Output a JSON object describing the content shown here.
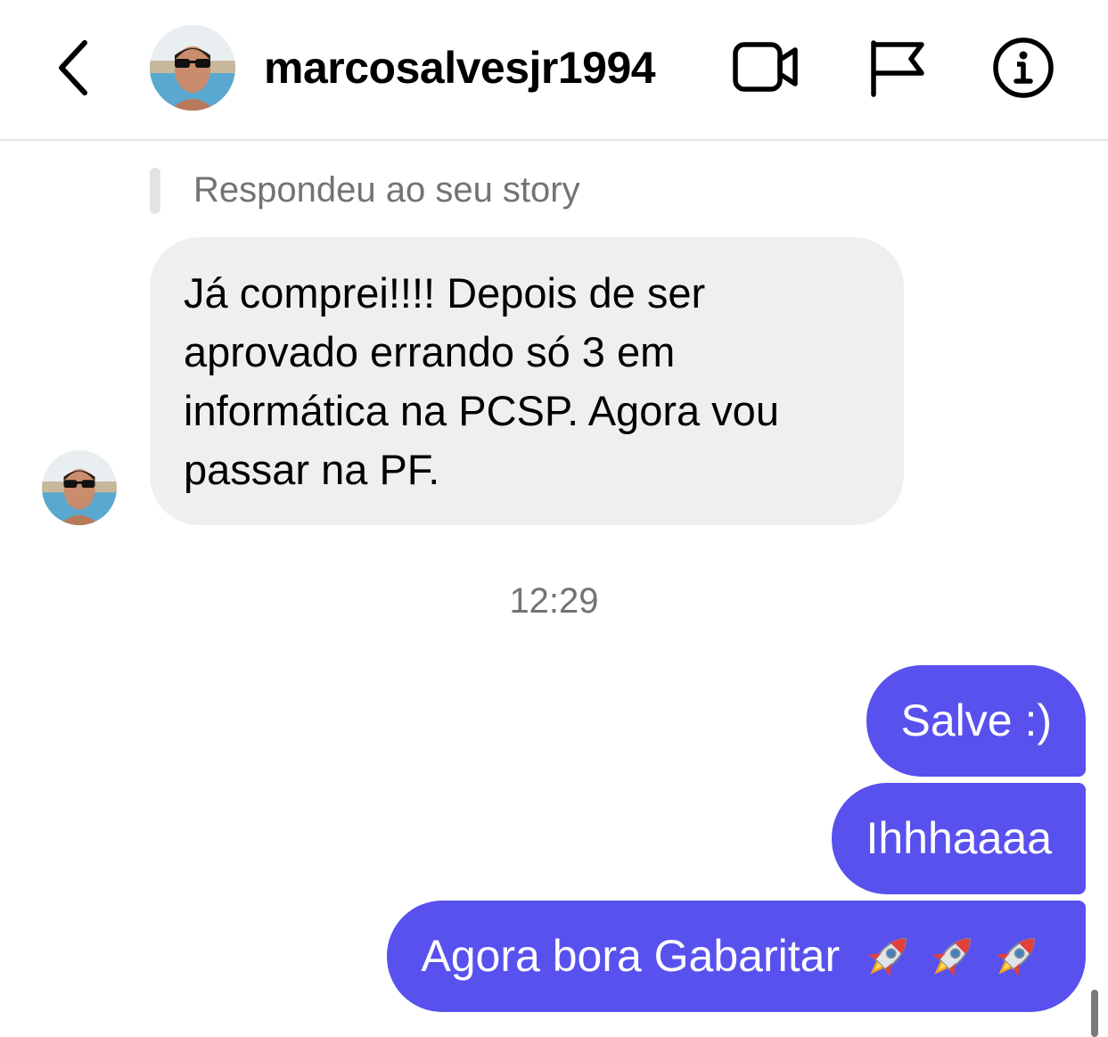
{
  "header": {
    "username": "marcosalvesjr1994",
    "back_icon": "chevron-left-icon",
    "video_icon": "video-camera-icon",
    "flag_icon": "flag-icon",
    "info_icon": "info-icon"
  },
  "conversation": {
    "reply_context": "Respondeu ao seu story",
    "incoming_message": "Já comprei!!!! Depois de ser aprovado errando só 3 em informática na PCSP. Agora vou passar na PF.",
    "timestamp": "12:29",
    "outgoing_messages": [
      {
        "text": "Salve :)"
      },
      {
        "text": "Ihhhaaaa"
      },
      {
        "text": "Agora bora Gabaritar",
        "emoji": "🚀🚀🚀"
      }
    ]
  },
  "colors": {
    "outgoing_bubble": "#5851ee",
    "incoming_bubble": "#efefef",
    "secondary_text": "#737373"
  }
}
